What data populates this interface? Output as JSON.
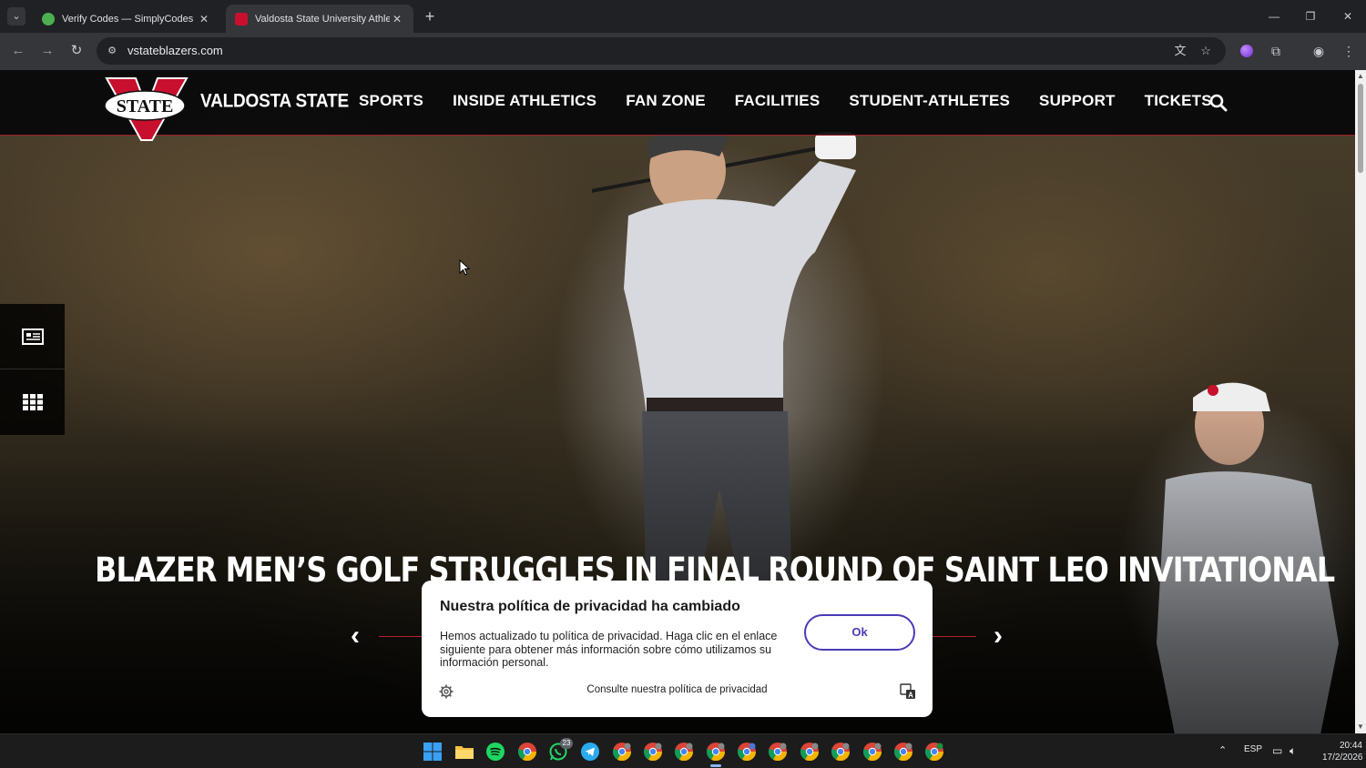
{
  "browser": {
    "tabs": [
      {
        "title": "Verify Codes — SimplyCodes",
        "favicon_color": "#4caf50"
      },
      {
        "title": "Valdosta State University Athletics",
        "favicon_color": "#c8102e"
      }
    ],
    "url": "vstateblazers.com",
    "window_controls": {
      "minimize": "—",
      "restore": "❐",
      "close": "✕"
    }
  },
  "site": {
    "brand": "VALDOSTA STATE",
    "logo": {
      "text": "STATE",
      "primary_color": "#c8102e"
    },
    "nav": [
      "SPORTS",
      "INSIDE ATHLETICS",
      "FAN ZONE",
      "FACILITIES",
      "STUDENT-ATHLETES",
      "SUPPORT",
      "TICKETS"
    ],
    "accent_color": "#b3202c"
  },
  "hero": {
    "headline": "BLAZER MEN’S GOLF STRUGGLES IN FINAL ROUND OF SAINT LEO INVITATIONAL",
    "prev_arrow": "‹",
    "next_arrow": "›"
  },
  "side_rail": {
    "top_icon": "news-icon",
    "bottom_icon": "grid-icon"
  },
  "privacy_dialog": {
    "title": "Nuestra política de privacidad ha cambiado",
    "body": "Hemos actualizado tu política de privacidad. Haga clic en el enlace siguiente para obtener más información sobre cómo utilizamos su información personal.",
    "ok_label": "Ok",
    "link_label": "Consulte nuestra política de privacidad",
    "button_color": "#4b3bb5"
  },
  "taskbar": {
    "whatsapp_badge": "23",
    "language": "ESP",
    "time": "20:44",
    "date": "17/2/2026"
  }
}
